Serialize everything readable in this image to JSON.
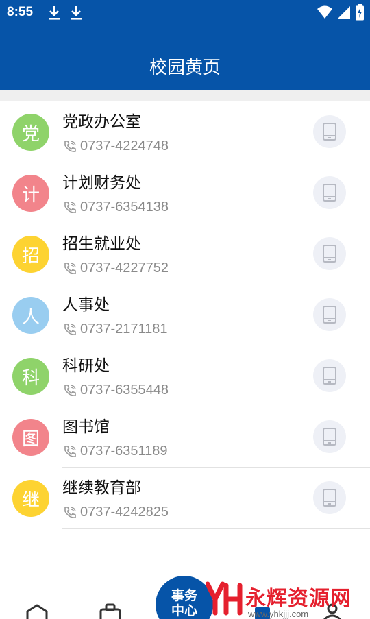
{
  "status_bar": {
    "time": "8:55",
    "left_icons": [
      "download-icon",
      "download-icon"
    ],
    "right_icons": [
      "wifi-icon",
      "cellular-signal-icon",
      "battery-charging-icon"
    ]
  },
  "app_bar": {
    "title": "校园黄页"
  },
  "colors": {
    "primary": "#0654a8",
    "green": "#8fd36a",
    "red": "#f2848b",
    "yellow": "#fdd332",
    "blue": "#99cdf0"
  },
  "contacts": [
    {
      "avatar_char": "党",
      "name": "党政办公室",
      "phone": "0737-4224748",
      "color": "#8fd36a"
    },
    {
      "avatar_char": "计",
      "name": "计划财务处",
      "phone": "0737-6354138",
      "color": "#f2848b"
    },
    {
      "avatar_char": "招",
      "name": "招生就业处",
      "phone": "0737-4227752",
      "color": "#fdd332"
    },
    {
      "avatar_char": "人",
      "name": "人事处",
      "phone": "0737-2171181",
      "color": "#99cdf0"
    },
    {
      "avatar_char": "科",
      "name": "科研处",
      "phone": "0737-6355448",
      "color": "#8fd36a"
    },
    {
      "avatar_char": "图",
      "name": "图书馆",
      "phone": "0737-6351189",
      "color": "#f2848b"
    },
    {
      "avatar_char": "继",
      "name": "继续教育部",
      "phone": "0737-4242825",
      "color": "#fdd332"
    }
  ],
  "bottom_nav": {
    "center_label_line1": "事务",
    "center_label_line2": "中心",
    "icons": [
      "home-icon",
      "briefcase-icon",
      "book-icon",
      "user-icon"
    ]
  },
  "watermark": {
    "text": "永辉资源网",
    "url": "www.yhkjjj.com",
    "logo": "YH"
  }
}
